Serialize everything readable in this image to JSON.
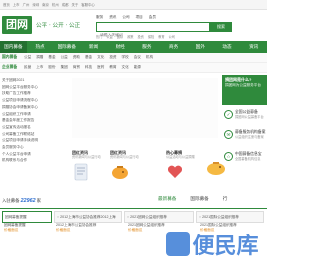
{
  "topbar": {
    "links": [
      "首页",
      "上市",
      "广州",
      "深圳",
      "南京",
      "杭州",
      "成都",
      "关于",
      "客服中心"
    ]
  },
  "header": {
    "logo_text": "团网",
    "slogan": "公平 · 公开 · 公正",
    "tabs": [
      "服务",
      "资讯",
      "公司",
      "项目",
      "会员"
    ],
    "search_placeholder": "请输入关键词",
    "search_button": "搜索",
    "hot_words": [
      "热门",
      "公益",
      "国际",
      "政策",
      "投资",
      "保险",
      "教育",
      "公司"
    ]
  },
  "nav": {
    "items": [
      "国内募备",
      "热点",
      "国际募备",
      "新闻",
      "财经",
      "服务",
      "商务",
      "国外",
      "动态",
      "资讯"
    ]
  },
  "subnav": {
    "rows": [
      {
        "category": "国内募备",
        "links": [
          "公益",
          "捐赠",
          "基金",
          "公益",
          "资助",
          "基金",
          "文化",
          "投资",
          "学校",
          "会议",
          "机构"
        ]
      },
      {
        "category": "企业募备",
        "links": [
          "民营",
          "上市",
          "股份",
          "集团",
          "商贸",
          "科技",
          "医药",
          "教育",
          "文化",
          "能源"
        ]
      }
    ]
  },
  "left_list": {
    "items": [
      "关于团网2021",
      "团网公益平台服务中心",
      "扶助广告工作推荐",
      "公益项目申请流程中心",
      "捐赠协会申请备案中心",
      "公益组织工作申请",
      "基金会年度工作报告",
      "公益宣传活动报名",
      "公司募备工作联络站",
      "公益项目申请手续说明",
      "会员服务中心",
      "个人公益平台申请",
      "机构联系与合作"
    ]
  },
  "sidebar": {
    "head_title": "捐团网是什么?",
    "head_sub": "捐团网为公益服务平台",
    "items": [
      {
        "icon": "✓",
        "title": "全国公益募备",
        "sub": "捐团网公益募备平台"
      },
      {
        "icon": "✉",
        "title": "募备服务机构备案",
        "sub": "公益组织注册与备案"
      },
      {
        "icon": "☆",
        "title": "中国募备信息宝",
        "sub": "全国募备机构信息"
      }
    ]
  },
  "features": [
    {
      "title": "团红资讯",
      "sub": "资讯新闻与公益行动",
      "icon": "document"
    },
    {
      "title": "团红资讯",
      "sub": "资讯新闻与公益行动",
      "icon": "piggy-bank"
    },
    {
      "title": "热心募捐",
      "sub": "公益活动与公益捐赠",
      "icon": "heart"
    }
  ],
  "counts": {
    "label": "入驻募备",
    "value": "22962",
    "unit": "家"
  },
  "category_tabs": [
    "最新募备",
    "国际募备",
    "行"
  ],
  "bottom_tabs": [
    {
      "label": "团网募备提醒",
      "closable": false
    },
    {
      "label": "2012上海市公益协会推荐2012上海",
      "closable": true
    },
    {
      "label": "2021团网公益组织推荐",
      "closable": true
    },
    {
      "label": "2021国际公益组织推荐",
      "closable": true
    }
  ],
  "details": [
    {
      "line1": "团网募备提醒",
      "line2": "价格面议"
    },
    {
      "line1": "2012上海市公益协会推荐",
      "line2": "价格面议"
    },
    {
      "line1": "2021团网公益组织推荐",
      "line2": "价格面议"
    },
    {
      "line1": "2021国际公益组织推荐",
      "line2": "价格面议"
    }
  ],
  "watermark": {
    "text": "便民库"
  }
}
